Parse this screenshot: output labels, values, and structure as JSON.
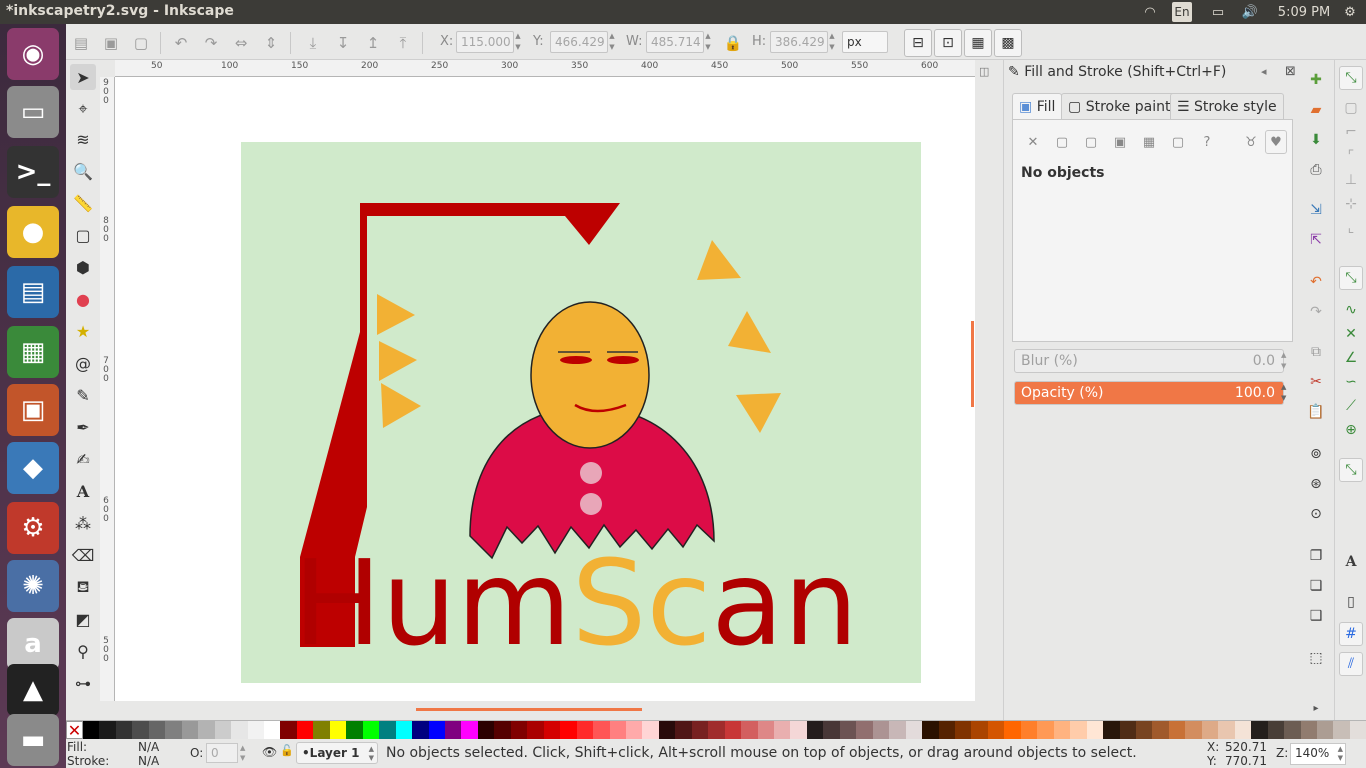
{
  "window": {
    "title": "*inkscapetry2.svg - Inkscape",
    "time": "5:09 PM",
    "keyboard": "En"
  },
  "launcher": [
    {
      "name": "ubuntu-dash",
      "glyph": "◉",
      "color": "#8a3b6b"
    },
    {
      "name": "files",
      "glyph": "▭",
      "color": "#8b8b8b"
    },
    {
      "name": "terminal",
      "glyph": ">_",
      "color": "#333"
    },
    {
      "name": "chrome",
      "glyph": "●",
      "color": "#e8b72a"
    },
    {
      "name": "writer",
      "glyph": "▤",
      "color": "#2b6aa8"
    },
    {
      "name": "calc",
      "glyph": "▦",
      "color": "#3a8a3a"
    },
    {
      "name": "impress",
      "glyph": "▣",
      "color": "#c2552a"
    },
    {
      "name": "shotwell",
      "glyph": "◆",
      "color": "#3a79b8"
    },
    {
      "name": "settings",
      "glyph": "⚙",
      "color": "#c0392b"
    },
    {
      "name": "unity-tweak",
      "glyph": "✺",
      "color": "#4a6fa5"
    },
    {
      "name": "amazon",
      "glyph": "a",
      "color": "#c9c9c9"
    },
    {
      "name": "inkscape",
      "glyph": "▲",
      "color": "#222"
    },
    {
      "name": "trash",
      "glyph": "▬",
      "color": "#8a8a8a"
    }
  ],
  "toolbar": {
    "x_label": "X:",
    "x": "115.000",
    "y_label": "Y:",
    "y": "466.429",
    "w_label": "W:",
    "w": "485.714",
    "h_label": "H:",
    "h": "386.429",
    "unit": "px"
  },
  "rulers": {
    "top": [
      "50",
      "100",
      "150",
      "200",
      "250",
      "300",
      "350",
      "400",
      "450",
      "500",
      "550",
      "600"
    ],
    "left": [
      "900",
      "800",
      "700",
      "600",
      "500"
    ]
  },
  "artwork": {
    "background": "#d0eacb",
    "gallows_color": "#bd0000",
    "triangle_color": "#f2b134",
    "face_color": "#f2b134",
    "body_color": "#dc0c47",
    "button_color": "#e8a6b8",
    "text_part1": "Hum",
    "text_part2": "Sc",
    "text_part3": "an",
    "text_dark": "#b00000",
    "text_orange": "#f2b134"
  },
  "dock": {
    "title": "Fill and Stroke (Shift+Ctrl+F)",
    "tabs": [
      "Fill",
      "Stroke paint",
      "Stroke style"
    ],
    "message": "No objects",
    "blur_label": "Blur (%)",
    "blur_value": "0.0",
    "opacity_label": "Opacity (%)",
    "opacity_value": "100.0"
  },
  "palette": [
    "#000000",
    "#1a1a1a",
    "#333333",
    "#4d4d4d",
    "#666666",
    "#808080",
    "#999999",
    "#b3b3b3",
    "#cccccc",
    "#e6e6e6",
    "#f2f2f2",
    "#ffffff",
    "#800000",
    "#ff0000",
    "#808000",
    "#ffff00",
    "#008000",
    "#00ff00",
    "#008080",
    "#00ffff",
    "#000080",
    "#0000ff",
    "#800080",
    "#ff00ff",
    "#2b0000",
    "#550000",
    "#800000",
    "#aa0000",
    "#d40000",
    "#ff0000",
    "#ff2a2a",
    "#ff5555",
    "#ff8080",
    "#ffaaaa",
    "#ffd5d5",
    "#280b0b",
    "#501616",
    "#782121",
    "#a02c2c",
    "#c83737",
    "#d35f5f",
    "#de8787",
    "#e9afaf",
    "#f4d7d7",
    "#241c1c",
    "#483737",
    "#6c5353",
    "#916f6f",
    "#ac9393",
    "#c8b7b7",
    "#e3dbdb",
    "#2b1100",
    "#552200",
    "#803300",
    "#aa4400",
    "#d45500",
    "#ff6600",
    "#ff7f2a",
    "#ff9955",
    "#ffb380",
    "#ffccaa",
    "#ffe6d5",
    "#28170b",
    "#502d16",
    "#784421",
    "#a05a2c",
    "#c87137",
    "#d38d5f",
    "#deaa87",
    "#e9c6af",
    "#f4e3d7",
    "#241f1c",
    "#483e37",
    "#6c5d53",
    "#917c6f",
    "#ac9d93",
    "#c8beb7",
    "#e3dedb"
  ],
  "status": {
    "fill_label": "Fill:",
    "fill": "N/A",
    "stroke_label": "Stroke:",
    "stroke": "N/A",
    "o_label": "O:",
    "o_value": "0",
    "layer": "•Layer 1",
    "message": "No objects selected. Click, Shift+click, Alt+scroll mouse on top of objects, or drag around objects to select.",
    "x_label": "X:",
    "x": "520.71",
    "y_label": "Y:",
    "y": "770.71",
    "z_label": "Z:",
    "zoom": "140%"
  }
}
